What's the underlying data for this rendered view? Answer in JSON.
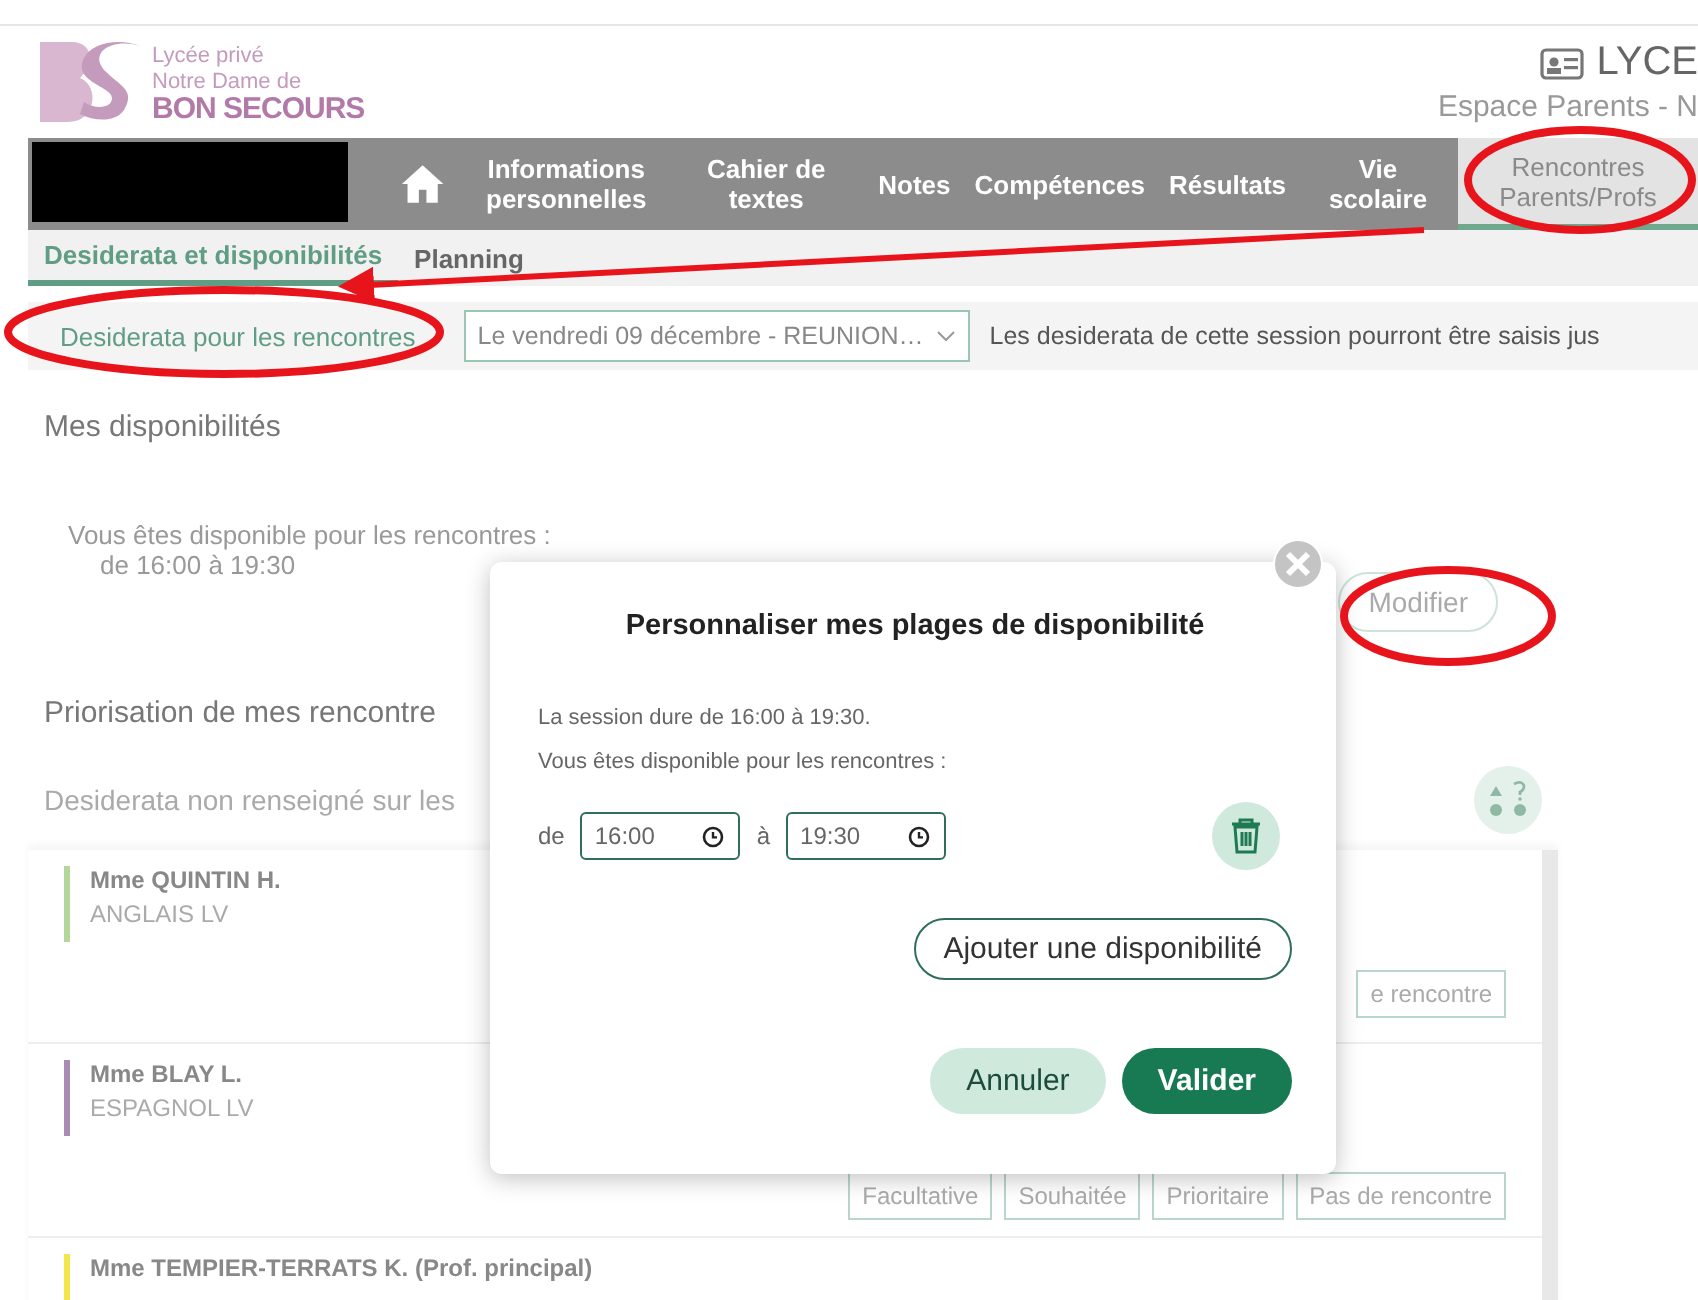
{
  "header": {
    "logo_lines": [
      "Lycée privé",
      "Notre Dame de",
      "BON SECOURS"
    ],
    "school": "LYCE",
    "space": "Espace Parents - N"
  },
  "nav": {
    "items": [
      {
        "label": "Informations personnelles",
        "selected": false
      },
      {
        "label": "Cahier de textes",
        "selected": false
      },
      {
        "label": "Notes",
        "selected": false
      },
      {
        "label": "Compétences",
        "selected": false
      },
      {
        "label": "Résultats",
        "selected": false
      },
      {
        "label": "Vie scolaire",
        "selected": false
      },
      {
        "label": "Rencontres Parents/Profs",
        "selected": true
      }
    ]
  },
  "subtabs": [
    {
      "label": "Desiderata et disponibilités",
      "selected": true
    },
    {
      "label": "Planning",
      "selected": false
    }
  ],
  "session_bar": {
    "label": "Desiderata pour les rencontres",
    "select_value": "Le vendredi 09 décembre - REUNION…",
    "note": "Les desiderata de cette session pourront être saisis jus"
  },
  "availability": {
    "title": "Mes disponibilités",
    "text": "Vous êtes disponible pour les rencontres :",
    "range": "de 16:00 à 19:30",
    "button": "Modifier"
  },
  "priority": {
    "title": "Priorisation de mes rencontre",
    "note": "Desiderata non renseigné sur les"
  },
  "teachers": [
    {
      "name": "Mme QUINTIN H.",
      "subject": "ANGLAIS LV",
      "color": "#b5d69a",
      "buttons": [
        "e rencontre"
      ]
    },
    {
      "name": "Mme BLAY L.",
      "subject": "ESPAGNOL LV",
      "color": "#a88cb4",
      "buttons": [
        "Facultative",
        "Souhaitée",
        "Prioritaire",
        "Pas de rencontre"
      ]
    },
    {
      "name": "Mme TEMPIER-TERRATS K. (Prof. principal)",
      "color": "#f2e64a"
    }
  ],
  "modal": {
    "title": "Personnaliser mes plages de disponibilité",
    "session": "La session dure de 16:00 à 19:30.",
    "available": "Vous êtes disponible pour les rencontres :",
    "ranges": [
      {
        "from_label": "de",
        "from": "16:00",
        "to_label": "à",
        "to": "19:30"
      }
    ],
    "add_button": "Ajouter une disponibilité",
    "cancel": "Annuler",
    "confirm": "Valider"
  }
}
